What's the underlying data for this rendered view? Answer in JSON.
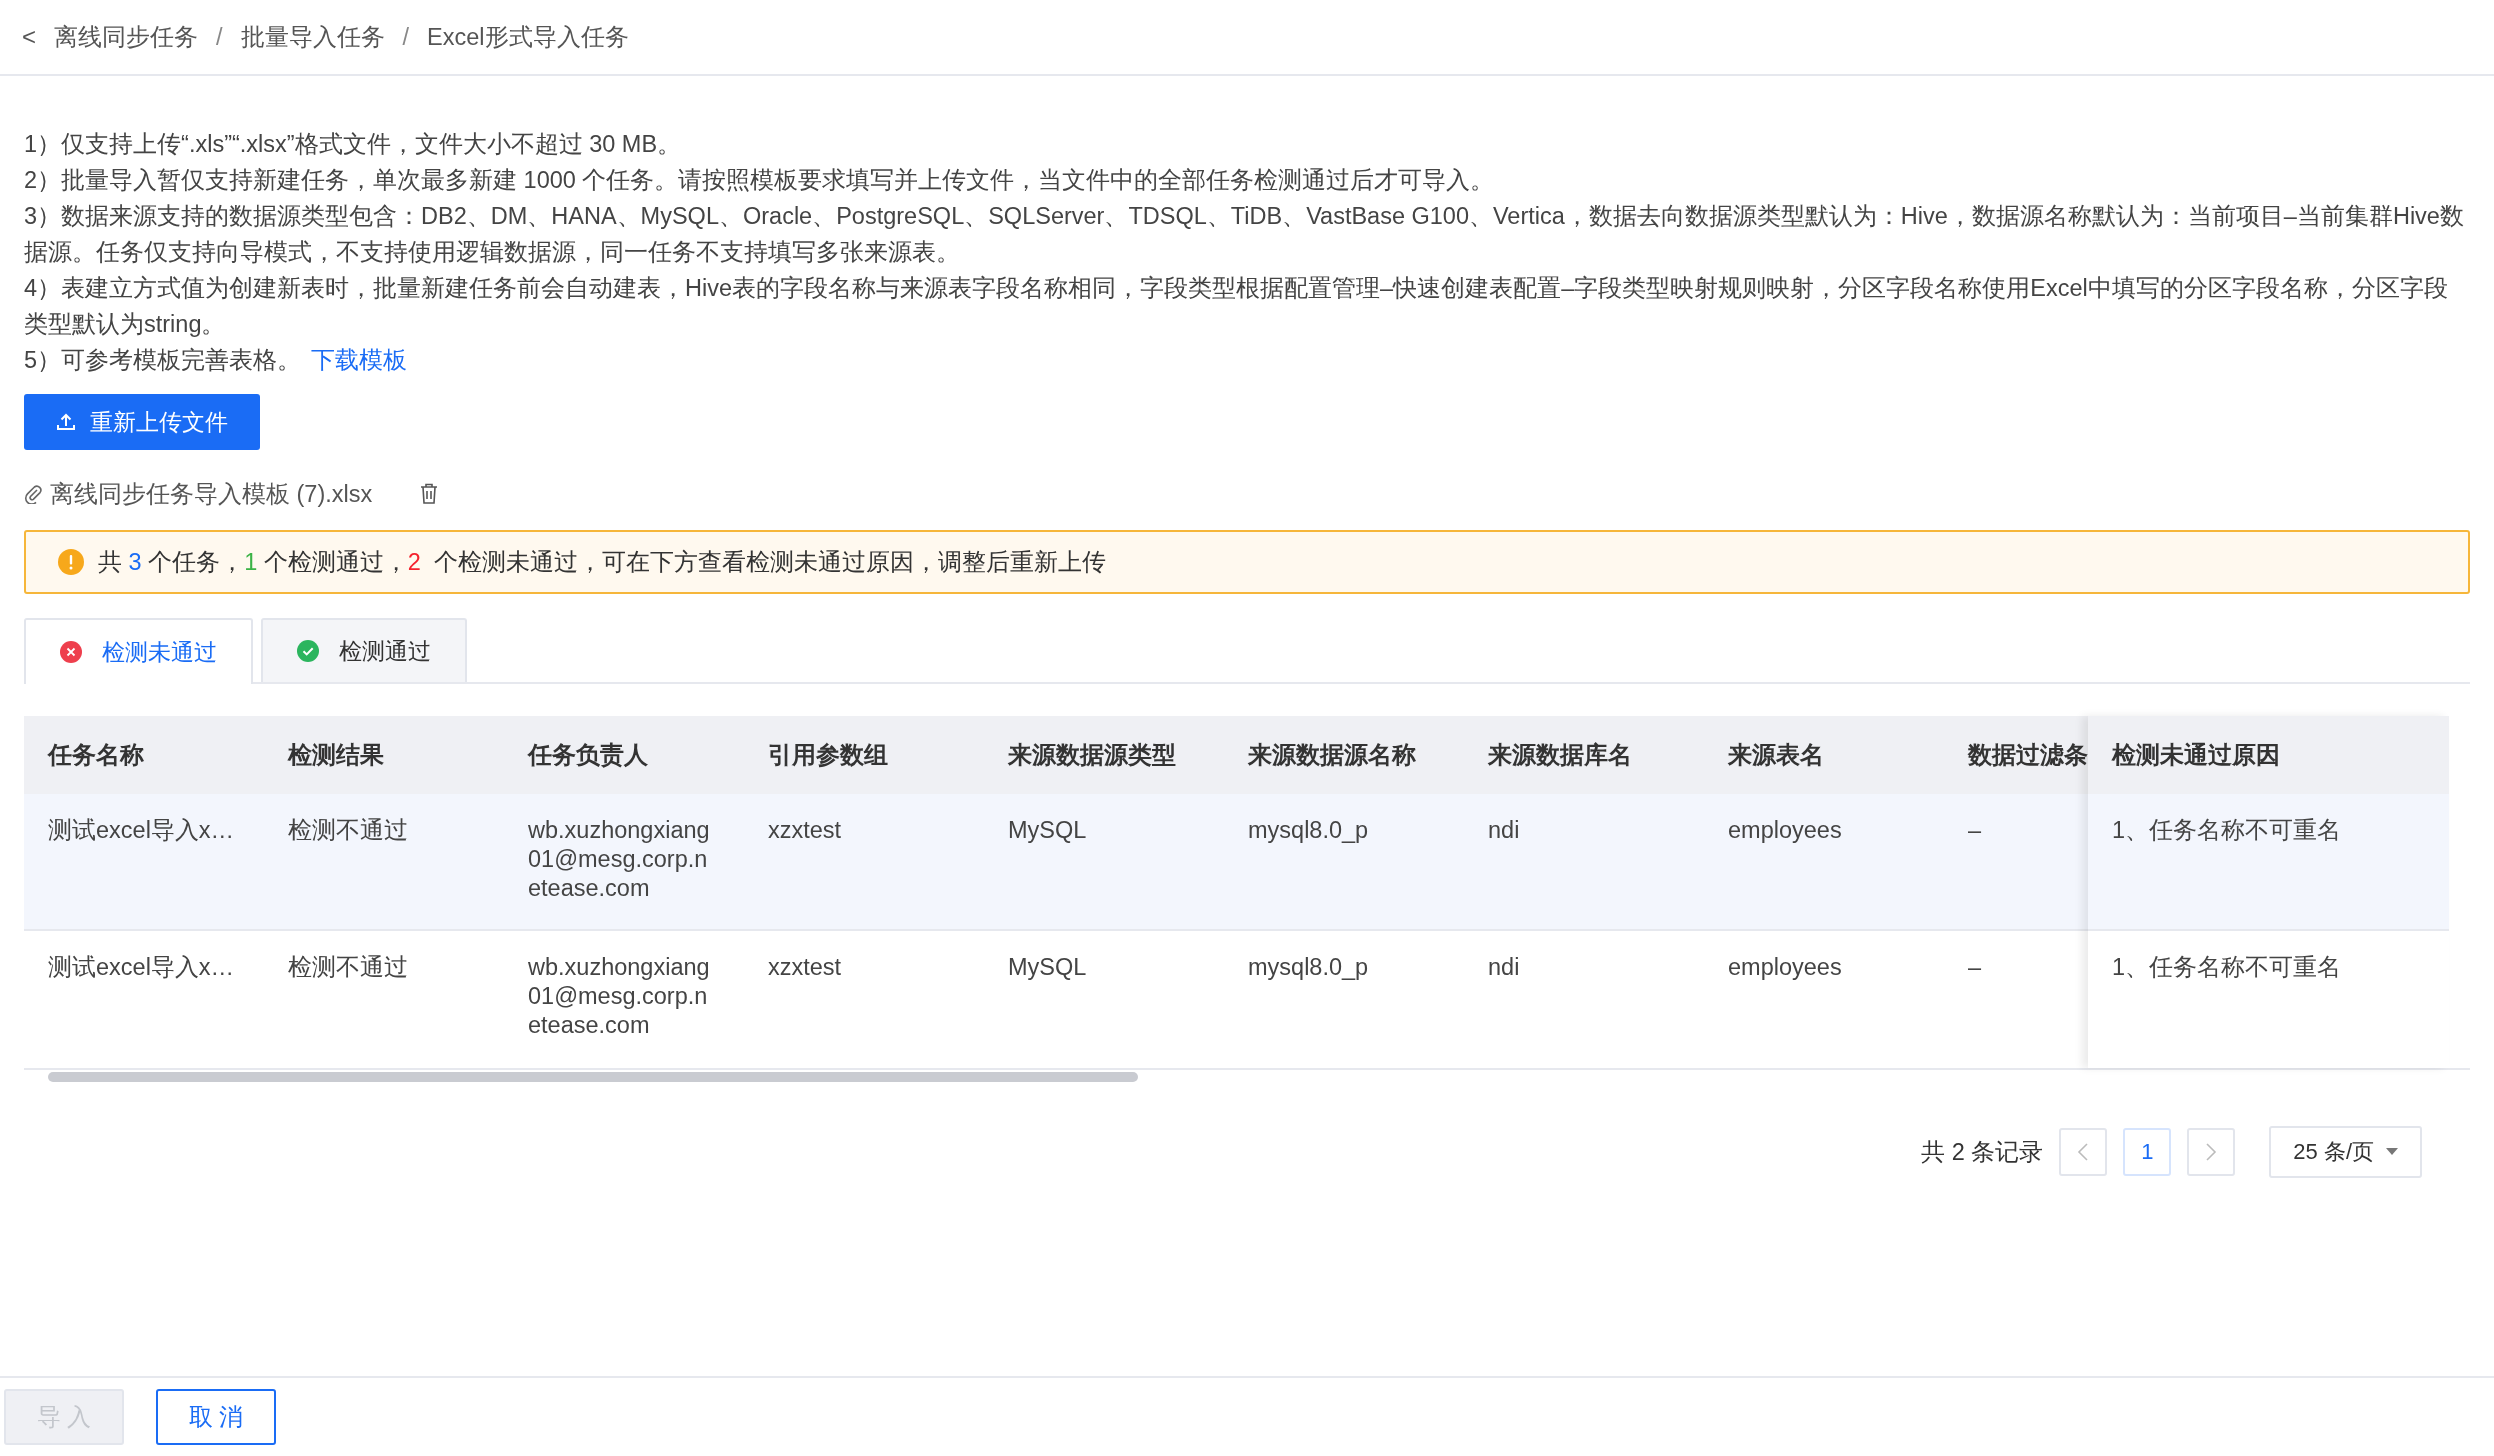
{
  "breadcrumb": {
    "back_icon": "<",
    "separator": "/",
    "items": [
      "离线同步任务",
      "批量导入任务",
      "Excel形式导入任务"
    ]
  },
  "notes": [
    {
      "text": "1）仅支持上传“.xls”“.xlsx”格式文件，文件大小不超过 30 MB。"
    },
    {
      "text": "2）批量导入暂仅支持新建任务，单次最多新建 1000 个任务。请按照模板要求填写并上传文件，当文件中的全部任务检测通过后才可导入。"
    },
    {
      "text": "3）数据来源支持的数据源类型包含：DB2、DM、HANA、MySQL、Oracle、PostgreSQL、SQLServer、TDSQL、TiDB、VastBase G100、Vertica，数据去向数据源类型默认为：Hive，数据源名称默认为：当前项目–当前集群Hive数据源。任务仅支持向导模式，不支持使用逻辑数据源，同一任务不支持填写多张来源表。"
    },
    {
      "text": "4）表建立方式值为创建新表时，批量新建任务前会自动建表，Hive表的字段名称与来源表字段名称相同，字段类型根据配置管理–快速创建表配置–字段类型映射规则映射，分区字段名称使用Excel中填写的分区字段名称，分区字段类型默认为string。"
    },
    {
      "text": "5）可参考模板完善表格。",
      "link": "下载模板"
    }
  ],
  "upload_button": "重新上传文件",
  "file": {
    "name": "离线同步任务导入模板 (7).xlsx"
  },
  "alert": {
    "segments": [
      {
        "kind": "text",
        "text": "共 "
      },
      {
        "kind": "total",
        "text": "3"
      },
      {
        "kind": "text",
        "text": " 个任务，"
      },
      {
        "kind": "passed",
        "text": "1"
      },
      {
        "kind": "text",
        "text": " 个检测通过，"
      },
      {
        "kind": "failed",
        "text": "2"
      },
      {
        "kind": "text",
        "text": "  个检测未通过，可在下方查看检测未通过原因，调整后重新上传"
      }
    ]
  },
  "tabs": [
    {
      "label": "检测未通过",
      "kind": "failed",
      "selected": true
    },
    {
      "label": "检测通过",
      "kind": "passed",
      "selected": false
    }
  ],
  "table": {
    "columns": [
      "任务名称",
      "检测结果",
      "任务负责人",
      "引用参数组",
      "来源数据源类型",
      "来源数据源名称",
      "来源数据库名",
      "来源表名",
      "数据过滤条"
    ],
    "fixed_column": "检测未通过原因",
    "rows": [
      {
        "highlighted": true,
        "cells": [
          "测试excel导入x…",
          "检测不通过",
          "wb.xuzhongxiang01@mesg.corp.netease.com",
          "xzxtest",
          "MySQL",
          "mysql8.0_p",
          "ndi",
          "employees",
          "–"
        ],
        "reason": "1、任务名称不可重名"
      },
      {
        "highlighted": false,
        "cells": [
          "测试excel导入x…",
          "检测不通过",
          "wb.xuzhongxiang01@mesg.corp.netease.com",
          "xzxtest",
          "MySQL",
          "mysql8.0_p",
          "ndi",
          "employees",
          "–"
        ],
        "reason": "1、任务名称不可重名"
      }
    ]
  },
  "pagination": {
    "total": "共 2 条记录",
    "pages": [
      {
        "label": "1",
        "selected": true
      }
    ],
    "page_size": "25 条/页"
  },
  "footer": [
    {
      "label": "导 入",
      "kind": "default",
      "disabled": true
    },
    {
      "label": "取 消",
      "kind": "outline",
      "disabled": false
    }
  ]
}
